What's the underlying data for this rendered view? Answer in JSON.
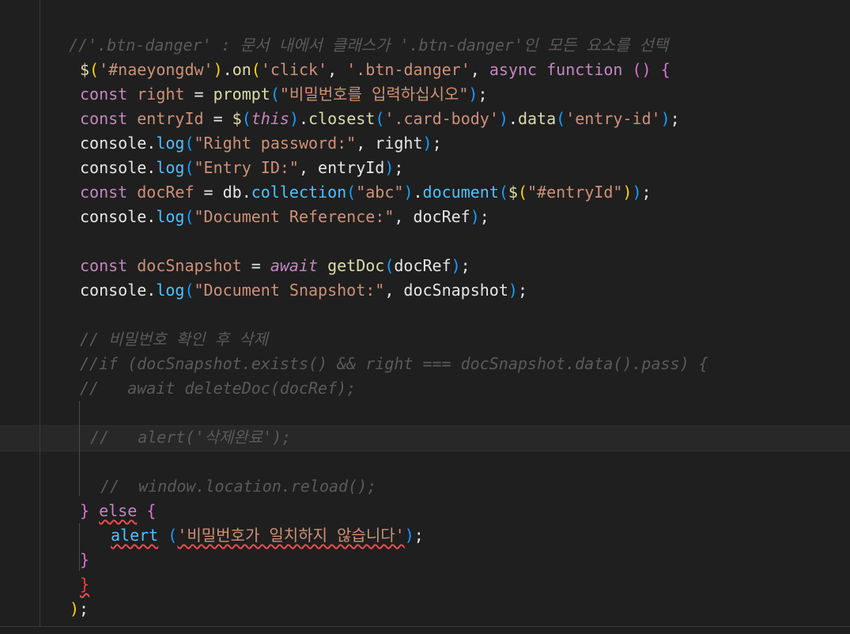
{
  "editor": {
    "lines": [
      {
        "id": "l1",
        "indent": 0,
        "tokens": [
          {
            "c": "cm",
            "t": "//'.btn-danger' : 문서 내에서 클래스가 '.btn-danger'인 모든 요소를 선택"
          }
        ]
      },
      {
        "id": "l2",
        "indent": 0,
        "tokens": [
          {
            "c": "fn",
            "t": "$"
          },
          {
            "c": "brace-y",
            "t": "("
          },
          {
            "c": "str",
            "t": "'#naeyongdw'"
          },
          {
            "c": "brace-y",
            "t": ")"
          },
          {
            "c": "plain",
            "t": "."
          },
          {
            "c": "fn",
            "t": "on"
          },
          {
            "c": "brace-y",
            "t": "("
          },
          {
            "c": "str",
            "t": "'click'"
          },
          {
            "c": "plain",
            "t": ", "
          },
          {
            "c": "str",
            "t": "'.btn-danger'"
          },
          {
            "c": "plain",
            "t": ", "
          },
          {
            "c": "kw",
            "t": "async "
          },
          {
            "c": "kw",
            "t": "function "
          },
          {
            "c": "brace-p",
            "t": "() "
          },
          {
            "c": "brace-p",
            "t": "{"
          }
        ]
      },
      {
        "id": "l3",
        "indent": 0,
        "tokens": [
          {
            "c": "kw",
            "t": "const "
          },
          {
            "c": "str",
            "t": "right"
          },
          {
            "c": "plain",
            "t": " = "
          },
          {
            "c": "fn",
            "t": "prompt"
          },
          {
            "c": "brace-b",
            "t": "("
          },
          {
            "c": "str",
            "t": "\"비밀번호를 입력하십시오\""
          },
          {
            "c": "brace-b",
            "t": ")"
          },
          {
            "c": "plain",
            "t": ";"
          }
        ]
      },
      {
        "id": "l4",
        "indent": 0,
        "tokens": [
          {
            "c": "kw",
            "t": "const "
          },
          {
            "c": "str",
            "t": "entryId"
          },
          {
            "c": "plain",
            "t": " = "
          },
          {
            "c": "fn",
            "t": "$"
          },
          {
            "c": "brace-b",
            "t": "("
          },
          {
            "c": "kw2",
            "t": "this"
          },
          {
            "c": "brace-b",
            "t": ")"
          },
          {
            "c": "plain",
            "t": "."
          },
          {
            "c": "fn",
            "t": "closest"
          },
          {
            "c": "brace-b",
            "t": "("
          },
          {
            "c": "str",
            "t": "'.card-body'"
          },
          {
            "c": "brace-b",
            "t": ")"
          },
          {
            "c": "plain",
            "t": "."
          },
          {
            "c": "fn",
            "t": "data"
          },
          {
            "c": "brace-b",
            "t": "("
          },
          {
            "c": "str",
            "t": "'entry-id'"
          },
          {
            "c": "brace-b",
            "t": ")"
          },
          {
            "c": "plain",
            "t": ";"
          }
        ]
      },
      {
        "id": "l5",
        "indent": 0,
        "tokens": [
          {
            "c": "plain",
            "t": "console"
          },
          {
            "c": "plain",
            "t": "."
          },
          {
            "c": "prop",
            "t": "log"
          },
          {
            "c": "brace-b",
            "t": "("
          },
          {
            "c": "str",
            "t": "\"Right password:\""
          },
          {
            "c": "plain",
            "t": ", right"
          },
          {
            "c": "brace-b",
            "t": ")"
          },
          {
            "c": "plain",
            "t": ";"
          }
        ]
      },
      {
        "id": "l6",
        "indent": 0,
        "tokens": [
          {
            "c": "plain",
            "t": "console"
          },
          {
            "c": "plain",
            "t": "."
          },
          {
            "c": "prop",
            "t": "log"
          },
          {
            "c": "brace-b",
            "t": "("
          },
          {
            "c": "str",
            "t": "\"Entry ID:\""
          },
          {
            "c": "plain",
            "t": ", entryId"
          },
          {
            "c": "brace-b",
            "t": ")"
          },
          {
            "c": "plain",
            "t": ";"
          }
        ]
      },
      {
        "id": "l7",
        "indent": 0,
        "tokens": [
          {
            "c": "kw",
            "t": "const "
          },
          {
            "c": "str",
            "t": "docRef"
          },
          {
            "c": "plain",
            "t": " = db."
          },
          {
            "c": "prop",
            "t": "collection"
          },
          {
            "c": "brace-b",
            "t": "("
          },
          {
            "c": "str",
            "t": "\"abc\""
          },
          {
            "c": "brace-b",
            "t": ")"
          },
          {
            "c": "plain",
            "t": "."
          },
          {
            "c": "prop",
            "t": "document"
          },
          {
            "c": "brace-b",
            "t": "("
          },
          {
            "c": "fn",
            "t": "$"
          },
          {
            "c": "brace-y",
            "t": "("
          },
          {
            "c": "str",
            "t": "\"#entryId\""
          },
          {
            "c": "brace-y",
            "t": ")"
          },
          {
            "c": "brace-b",
            "t": ")"
          },
          {
            "c": "plain",
            "t": ";"
          }
        ]
      },
      {
        "id": "l8",
        "indent": 0,
        "tokens": [
          {
            "c": "plain",
            "t": "console"
          },
          {
            "c": "plain",
            "t": "."
          },
          {
            "c": "prop",
            "t": "log"
          },
          {
            "c": "brace-b",
            "t": "("
          },
          {
            "c": "str",
            "t": "\"Document Reference:\""
          },
          {
            "c": "plain",
            "t": ", docRef"
          },
          {
            "c": "brace-b",
            "t": ")"
          },
          {
            "c": "plain",
            "t": ";"
          }
        ]
      },
      {
        "id": "l9",
        "indent": 0,
        "tokens": []
      },
      {
        "id": "l10",
        "indent": 0,
        "tokens": [
          {
            "c": "kw",
            "t": "const "
          },
          {
            "c": "str",
            "t": "docSnapshot"
          },
          {
            "c": "plain",
            "t": " = "
          },
          {
            "c": "kw2",
            "t": "await "
          },
          {
            "c": "fn",
            "t": "getDoc"
          },
          {
            "c": "brace-b",
            "t": "("
          },
          {
            "c": "plain",
            "t": "docRef"
          },
          {
            "c": "brace-b",
            "t": ")"
          },
          {
            "c": "plain",
            "t": ";"
          }
        ]
      },
      {
        "id": "l11",
        "indent": 0,
        "tokens": [
          {
            "c": "plain",
            "t": "console"
          },
          {
            "c": "plain",
            "t": "."
          },
          {
            "c": "prop",
            "t": "log"
          },
          {
            "c": "brace-b",
            "t": "("
          },
          {
            "c": "str",
            "t": "\"Document Snapshot:\""
          },
          {
            "c": "plain",
            "t": ", docSnapshot"
          },
          {
            "c": "brace-b",
            "t": ")"
          },
          {
            "c": "plain",
            "t": ";"
          }
        ]
      },
      {
        "id": "l12",
        "indent": 0,
        "tokens": []
      },
      {
        "id": "l13",
        "indent": 0,
        "tokens": [
          {
            "c": "cm",
            "t": "// 비밀번호 확인 후 삭제"
          }
        ]
      },
      {
        "id": "l14",
        "indent": 0,
        "tokens": [
          {
            "c": "cm",
            "t": "//if (docSnapshot.exists() && right === docSnapshot.data().pass) {"
          }
        ]
      },
      {
        "id": "l15",
        "indent": 0,
        "tokens": [
          {
            "c": "cm",
            "t": "//   await deleteDoc(docRef);"
          }
        ]
      },
      {
        "id": "l16",
        "indent": 0,
        "tokens": []
      },
      {
        "id": "l17",
        "indent": 1,
        "tokens": [
          {
            "c": "cm",
            "t": "//   alert('삭제완료');"
          }
        ]
      },
      {
        "id": "l18",
        "indent": 0,
        "tokens": []
      },
      {
        "id": "l19",
        "indent": 2,
        "tokens": [
          {
            "c": "cm",
            "t": "//  window.location.reload();"
          }
        ]
      },
      {
        "id": "l20",
        "indent": 0,
        "tokens": [
          {
            "c": "brace-p",
            "t": "} "
          },
          {
            "c": "kw err",
            "t": "else"
          },
          {
            "c": "plain",
            "t": " "
          },
          {
            "c": "brace-p",
            "t": "{"
          }
        ]
      },
      {
        "id": "l21",
        "indent": 3,
        "tokens": [
          {
            "c": "prop err",
            "t": "alert"
          },
          {
            "c": "plain",
            "t": " "
          },
          {
            "c": "brace-b",
            "t": "("
          },
          {
            "c": "str err",
            "t": "'비밀번호가 일치하지 않습니다'"
          },
          {
            "c": "brace-b",
            "t": ")"
          },
          {
            "c": "plain",
            "t": ";"
          }
        ]
      },
      {
        "id": "l22",
        "indent": 0,
        "tokens": [
          {
            "c": "brace-p",
            "t": "}"
          }
        ]
      },
      {
        "id": "l23",
        "indent": 0,
        "tokens": [
          {
            "c": "brace-r err",
            "t": "}"
          }
        ]
      },
      {
        "id": "l24",
        "indent": -1,
        "tokens": [
          {
            "c": "brace-y",
            "t": ")"
          },
          {
            "c": "plain",
            "t": ";"
          }
        ]
      }
    ]
  }
}
